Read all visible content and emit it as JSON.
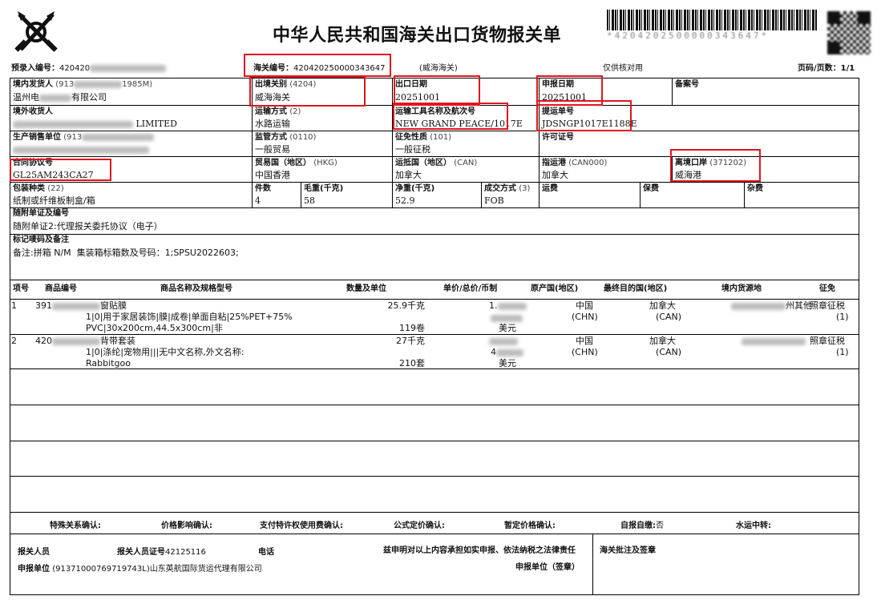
{
  "header": {
    "title": "中华人民共和国海关出口货物报关单",
    "barcode_text": "*4204202500000343647*",
    "prerecord_label": "预录入编号：",
    "prerecord_value": "420420",
    "customs_no_label": "海关编号：",
    "customs_no_value": "420420250000343647",
    "customs_name": "(威海海关)",
    "verify_only": "仅供核对用",
    "page_label": "页码/页数：1/1"
  },
  "row1": {
    "consignor_label": "境内发货人",
    "consignor_code": "(913",
    "consignor_code_tail": "1985M)",
    "consignor_name_a": "温州电",
    "consignor_name_b": "有限公司",
    "exit_customs_label": "出境关别",
    "exit_customs_code": "(4204)",
    "exit_customs_value": "威海海关",
    "export_date_label": "出口日期",
    "export_date_value": "20251001",
    "declare_date_label": "申报日期",
    "declare_date_value": "20251001",
    "record_no_label": "备案号"
  },
  "row2": {
    "consignee_label": "境外收货人",
    "consignee_value": "LIMITED",
    "transport_mode_label": "运输方式",
    "transport_mode_code": "(2)",
    "transport_mode_value": "水路运输",
    "conveyance_label": "运输工具名称及航次号",
    "conveyance_value": "NEW GRAND PEACE/1017E",
    "bl_label": "提运单号",
    "bl_value": "JDSNGP1017E1188E"
  },
  "row3": {
    "producer_label": "生产销售单位",
    "producer_code": "(913",
    "supervision_label": "监管方式",
    "supervision_code": "(0110)",
    "supervision_value": "一般贸易",
    "levy_label": "征免性质",
    "levy_code": "(101)",
    "levy_value": "一般征税",
    "license_label": "许可证号"
  },
  "row4": {
    "contract_label": "合同协议号",
    "contract_value": "GL25AM243CA27",
    "trade_country_label": "贸易国（地区）",
    "trade_country_code": "(HKG)",
    "trade_country_value": "中国香港",
    "dest_country_label": "运抵国（地区）",
    "dest_country_code": "(CAN)",
    "dest_country_value": "加拿大",
    "dest_port_label": "指运港",
    "dest_port_code": "(CAN000)",
    "dest_port_value": "加拿大",
    "exit_port_label": "离境口岸",
    "exit_port_code": "(371202)",
    "exit_port_value": "威海港"
  },
  "row5": {
    "pack_label": "包装种类",
    "pack_code": "(22)",
    "pack_value": "纸制或纤维板制盒/箱",
    "pieces_label": "件数",
    "pieces_value": "4",
    "gross_label": "毛重(千克)",
    "gross_value": "58",
    "net_label": "净重(千克)",
    "net_value": "52.9",
    "deal_label": "成交方式",
    "deal_code": "(3)",
    "deal_value": "FOB",
    "freight_label": "运费",
    "insurance_label": "保费",
    "misc_label": "杂费"
  },
  "docs": {
    "label": "随附单证及编号",
    "value": "随附单证2:代理报关委托协议（电子）"
  },
  "marks": {
    "label": "标记唛码及备注",
    "value": "备注:拼箱 N/M  集装箱标箱数及号码：1;SPSU2022603;"
  },
  "goods_header": {
    "seq": "项号",
    "code": "商品编号",
    "name": "商品名称及规格型号",
    "qty": "数量及单位",
    "price": "单价/总价/币制",
    "origin": "原产国(地区)",
    "final_dest": "最终目的国(地区)",
    "domestic_source": "境内货源地",
    "levy": "征免"
  },
  "goods": [
    {
      "seq": "1",
      "code": "391",
      "name_tail": "窗贴膜",
      "spec1": "1|0|用于家居装饰|膜|成卷|单面自粘|25%PET+75%",
      "spec2": "PVC|30x200cm,44.5x300cm|非",
      "qty1": "25.9千克",
      "qty2": "119卷",
      "price_prefix": "1.",
      "currency": "美元",
      "origin": "中国",
      "origin_code": "(CHN)",
      "dest": "加拿大",
      "dest_code": "(CAN)",
      "source": "州其他",
      "levy": "照章征税",
      "levy_code": "(1)"
    },
    {
      "seq": "2",
      "code": "420",
      "name_tail": "背带套装",
      "spec1": "1|0|涤纶|宠物用|||无中文名称,外文名称:",
      "spec2": "Rabbitgoo",
      "qty1": "27千克",
      "qty2": "210套",
      "price_prefix": "4",
      "currency": "美元",
      "origin": "中国",
      "origin_code": "(CHN)",
      "dest": "加拿大",
      "dest_code": "(CAN)",
      "source": "",
      "levy": "照章征税",
      "levy_code": "(1)"
    }
  ],
  "confirm": {
    "special": "特殊关系确认:",
    "price_impact": "价格影响确认:",
    "royalty": "支付特许权使用费确认:",
    "formula": "公式定价确认:",
    "provisional": "暂定价格确认:",
    "self_pay_label": "自报自缴:",
    "self_pay_value": "否",
    "transit": "水运中转:"
  },
  "footer": {
    "declarant_label": "报关人员",
    "declarant_cert_label": "报关人员证号",
    "declarant_cert_value": "42125116",
    "phone_label": "电话",
    "statement": "兹申明对以上内容承担如实申报、依法纳税之法律责任",
    "customs_note_label": "海关批注及签章",
    "declare_unit_label": "申报单位",
    "declare_unit_value": "(91371000769719743L)山东英航国际货运代理有限公司",
    "sign_label": "申报单位（签章）"
  }
}
